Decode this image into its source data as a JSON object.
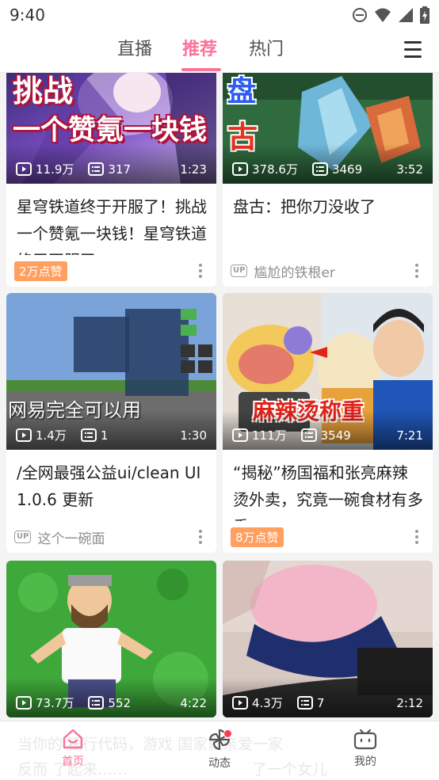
{
  "status_bar": {
    "time": "9:40"
  },
  "top_tabs": {
    "live": "直播",
    "recommend": "推荐",
    "hot": "热门"
  },
  "colors": {
    "accent": "#fb7299",
    "badge": "#ff9f60",
    "notify": "#fb3b50"
  },
  "cards": [
    {
      "overlay_line1": "挑战",
      "overlay_line2": "一个赞氪一块钱",
      "views": "11.9万",
      "danmaku": "317",
      "duration": "1:23",
      "title": "星穹铁道终于开服了！挑战一个赞氪一块钱！星穹铁道终于开服了",
      "badge": "2万点赞"
    },
    {
      "overlay_line1": "盘",
      "overlay_line2": "古",
      "views": "378.6万",
      "danmaku": "3469",
      "duration": "3:52",
      "title": "盘古：把你刀没收了",
      "uploader": "尴尬的铁根er"
    },
    {
      "overlay_line1": "网易完全可以用",
      "views": "1.4万",
      "danmaku": "1",
      "duration": "1:30",
      "title": "/全网最强公益ui/clean UI 1.0.6 更新",
      "uploader": "这个一碗面"
    },
    {
      "overlay_line1": "麻辣烫称重",
      "views": "111万",
      "danmaku": "3549",
      "duration": "7:21",
      "title": "“揭秘”杨国福和张亮麻辣烫外卖，究竟一碗食材有多重",
      "badge": "8万点赞"
    },
    {
      "views": "73.7万",
      "danmaku": "552",
      "duration": "4:22"
    },
    {
      "views": "4.3万",
      "danmaku": "7",
      "duration": "2:12"
    }
  ],
  "bottom_nav": {
    "home": "首页",
    "dynamic": "动态",
    "mine": "我的",
    "peek_left": "当你的 银行代码，游戏 国家就亲爱一家",
    "peek_left2": "反而 了起来……",
    "peek_right": "了一个女儿"
  },
  "icons": [
    "minus-circle-icon",
    "wifi-icon",
    "signal-icon",
    "battery-icon",
    "menu-icon",
    "play-count-icon",
    "danmaku-icon",
    "more-icon",
    "up-icon",
    "home-icon",
    "pinwheel-icon",
    "tv-icon"
  ]
}
